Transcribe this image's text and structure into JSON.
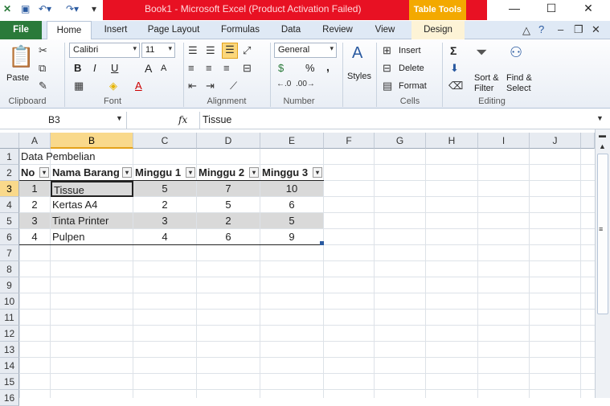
{
  "window": {
    "title": "Book1 - Microsoft Excel (Product Activation Failed)",
    "context_tab_group": "Table Tools",
    "controls": {
      "minimize": "—",
      "maximize": "☐",
      "close": "✕"
    },
    "colors": {
      "titlebar_alert": "#e81123",
      "context_group": "#f3a900",
      "file_tab": "#2a7a3a"
    }
  },
  "tabs": [
    "File",
    "Home",
    "Insert",
    "Page Layout",
    "Formulas",
    "Data",
    "Review",
    "View",
    "Design"
  ],
  "active_tab": "Home",
  "ribbon": {
    "clipboard": {
      "paste": "Paste",
      "label": "Clipboard"
    },
    "font": {
      "name": "Calibri",
      "size": "11",
      "label": "Font",
      "bold": "B",
      "italic": "I",
      "underline": "U",
      "grow": "A",
      "shrink": "A",
      "color_a": "A"
    },
    "alignment": {
      "label": "Alignment"
    },
    "number": {
      "format": "General",
      "percent": "%",
      "comma": ",",
      "label": "Number"
    },
    "styles": {
      "styles": "Styles"
    },
    "cells": {
      "insert": "Insert",
      "delete": "Delete",
      "format": "Format",
      "label": "Cells"
    },
    "editing": {
      "sum": "Σ",
      "sort": "Sort &",
      "filter": "Filter",
      "find": "Find &",
      "select": "Select",
      "label": "Editing"
    }
  },
  "formula_bar": {
    "name_box": "B3",
    "fx": "fx",
    "content": "Tissue"
  },
  "columns": [
    "A",
    "B",
    "C",
    "D",
    "E",
    "F",
    "G",
    "H",
    "I",
    "J"
  ],
  "selected_column": "B",
  "rows": [
    "1",
    "2",
    "3",
    "4",
    "5",
    "6",
    "7",
    "8",
    "9",
    "10",
    "11",
    "12",
    "13",
    "14",
    "15",
    "16"
  ],
  "selected_row": "3",
  "sheet": {
    "title_cell": "Data Pembelian",
    "headers": [
      "No",
      "Nama Barang",
      "Minggu 1",
      "Minggu 2",
      "Minggu 3"
    ],
    "records": [
      [
        "1",
        "Tissue",
        "5",
        "7",
        "10"
      ],
      [
        "2",
        "Kertas A4",
        "2",
        "5",
        "6"
      ],
      [
        "3",
        "Tinta Printer",
        "3",
        "2",
        "5"
      ],
      [
        "4",
        "Pulpen",
        "4",
        "6",
        "9"
      ]
    ]
  }
}
